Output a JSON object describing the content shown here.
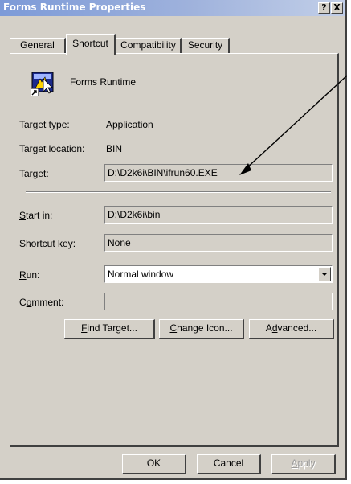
{
  "window": {
    "title": "Forms Runtime Properties",
    "help_button": "?",
    "close_button": "X"
  },
  "tabs": [
    {
      "label": "General"
    },
    {
      "label": "Shortcut"
    },
    {
      "label": "Compatibility"
    },
    {
      "label": "Security"
    }
  ],
  "shortcut": {
    "name": "Forms Runtime",
    "target_type_label": "Target type:",
    "target_type_value": "Application",
    "target_location_label": "Target location:",
    "target_location_value": "BIN",
    "target_label_key": "T",
    "target_label_rest": "arget:",
    "target_value": "D:\\D2k6i\\BIN\\ifrun60.EXE",
    "start_in_key": "S",
    "start_in_rest": "tart in:",
    "start_in_value": "D:\\D2k6i\\bin",
    "shortcut_key_pre": "Shortcut ",
    "shortcut_key_key": "k",
    "shortcut_key_post": "ey:",
    "shortcut_key_value": "None",
    "run_key": "R",
    "run_rest": "un:",
    "run_value": "Normal window",
    "comment_pre": "C",
    "comment_key": "o",
    "comment_post": "mment:",
    "comment_value": ""
  },
  "buttons": {
    "find_target_key": "F",
    "find_target_rest": "ind Target...",
    "change_icon_key": "C",
    "change_icon_rest": "hange Icon...",
    "advanced_pre": "A",
    "advanced_key": "d",
    "advanced_post": "vanced...",
    "ok": "OK",
    "cancel": "Cancel",
    "apply_key": "A",
    "apply_rest": "pply"
  },
  "colors": {
    "titlebar_start": "#7c9ad8",
    "titlebar_end": "#c2cfe8",
    "face": "#d4d0c8",
    "annotation_arrow": "#000000"
  }
}
